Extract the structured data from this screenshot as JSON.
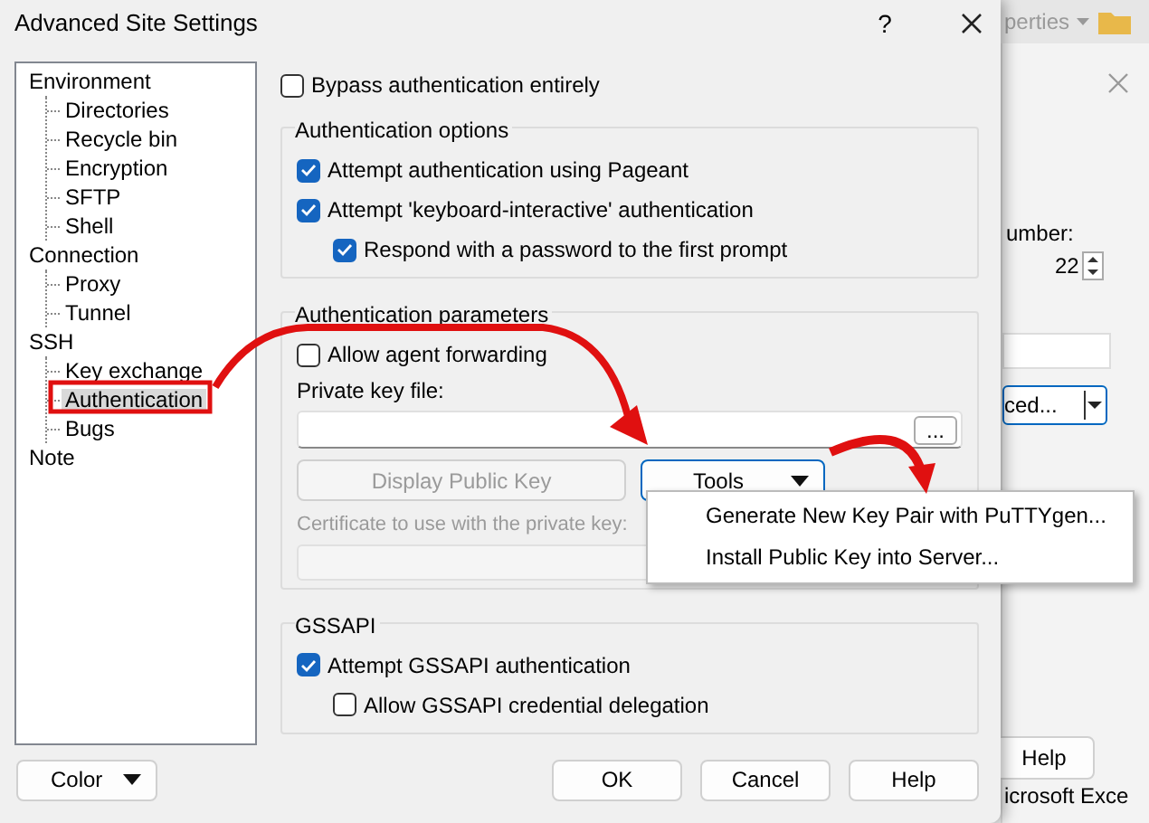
{
  "window": {
    "title": "Advanced Site Settings",
    "help_glyph": "?"
  },
  "tree": [
    {
      "label": "Environment",
      "selected": false,
      "children": [
        {
          "label": "Directories",
          "selected": false
        },
        {
          "label": "Recycle bin",
          "selected": false
        },
        {
          "label": "Encryption",
          "selected": false
        },
        {
          "label": "SFTP",
          "selected": false
        },
        {
          "label": "Shell",
          "selected": false
        }
      ]
    },
    {
      "label": "Connection",
      "selected": false,
      "children": [
        {
          "label": "Proxy",
          "selected": false
        },
        {
          "label": "Tunnel",
          "selected": false
        }
      ]
    },
    {
      "label": "SSH",
      "selected": false,
      "children": [
        {
          "label": "Key exchange",
          "selected": false
        },
        {
          "label": "Authentication",
          "selected": true
        },
        {
          "label": "Bugs",
          "selected": false
        }
      ]
    },
    {
      "label": "Note",
      "selected": false
    }
  ],
  "bypass": {
    "label": "Bypass authentication entirely",
    "checked": false
  },
  "authentication_options": {
    "title": "Authentication options",
    "options": [
      {
        "label": "Attempt authentication using Pageant",
        "checked": true,
        "indented": false
      },
      {
        "label": "Attempt 'keyboard-interactive' authentication",
        "checked": true,
        "indented": false
      },
      {
        "label": "Respond with a password to the first prompt",
        "checked": true,
        "indented": true
      }
    ]
  },
  "authentication_parameters": {
    "title": "Authentication parameters",
    "agent_forwarding": {
      "label": "Allow agent forwarding",
      "checked": false
    },
    "private_key_label": "Private key file:",
    "browse_button": "...",
    "display_key_button": {
      "label": "Display Public Key",
      "disabled": true
    },
    "tools_button": {
      "label": "Tools",
      "expanded": true
    },
    "certificate_label": {
      "label": "Certificate to use with the private key:",
      "disabled": true
    }
  },
  "tools_menu": [
    {
      "label": "Generate New Key Pair with PuTTYgen..."
    },
    {
      "label": "Install Public Key into Server..."
    }
  ],
  "gssapi": {
    "title": "GSSAPI",
    "options": [
      {
        "label": "Attempt GSSAPI authentication",
        "checked": true,
        "indented": false
      },
      {
        "label": "Allow GSSAPI credential delegation",
        "checked": false,
        "indented": true
      }
    ]
  },
  "footer": {
    "color_button": "Color",
    "buttons": [
      "OK",
      "Cancel",
      "Help"
    ]
  },
  "background_window": {
    "toolbar_text": "perties",
    "field_label": "umber:",
    "port_value": "22",
    "combo_text": "ced...",
    "button": "Help",
    "caption": "icrosoft Exce"
  }
}
